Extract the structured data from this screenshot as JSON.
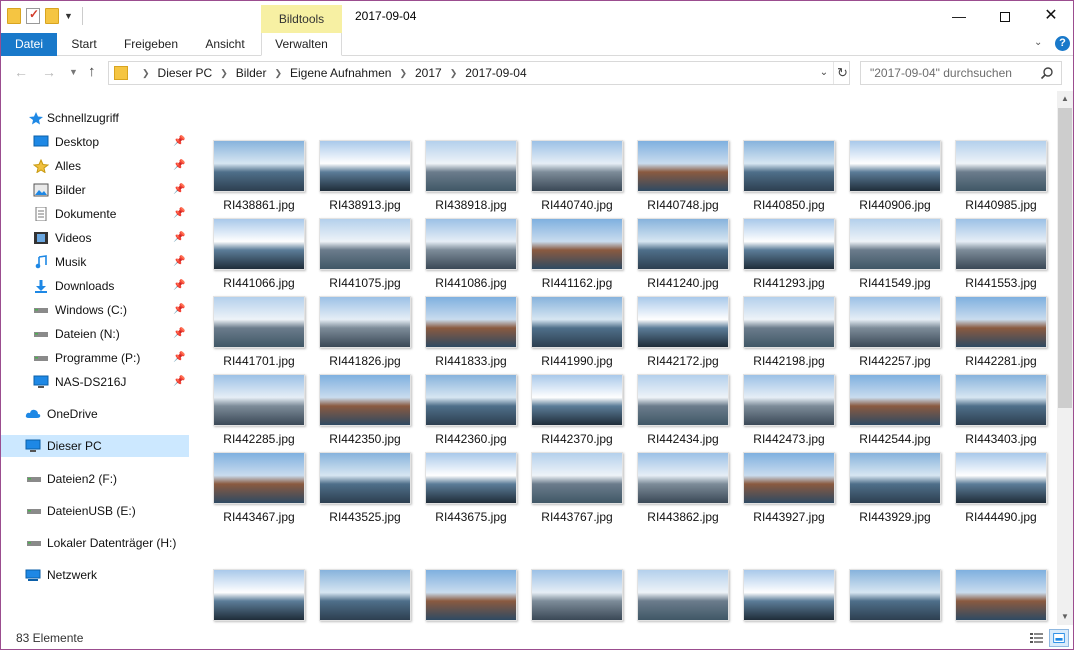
{
  "window": {
    "title": "2017-09-04",
    "context_tab_group": "Bildtools",
    "minimize_glyph": "—",
    "close_glyph": "✕"
  },
  "ribbon": {
    "tabs": [
      "Datei",
      "Start",
      "Freigeben",
      "Ansicht",
      "Verwalten"
    ],
    "help_glyph": "?",
    "accent": "#1979ca"
  },
  "address": {
    "breadcrumbs": [
      "Dieser PC",
      "Bilder",
      "Eigene Aufnahmen",
      "2017",
      "2017-09-04"
    ]
  },
  "search": {
    "placeholder": "\"2017-09-04\" durchsuchen"
  },
  "nav": {
    "quick_access": "Schnellzugriff",
    "pinned": [
      {
        "label": "Desktop",
        "icon": "desktop-icon"
      },
      {
        "label": "Alles",
        "icon": "star-icon"
      },
      {
        "label": "Bilder",
        "icon": "pictures-icon"
      },
      {
        "label": "Dokumente",
        "icon": "documents-icon"
      },
      {
        "label": "Videos",
        "icon": "videos-icon"
      },
      {
        "label": "Musik",
        "icon": "music-icon"
      },
      {
        "label": "Downloads",
        "icon": "downloads-icon"
      },
      {
        "label": "Windows (C:)",
        "icon": "drive-icon"
      },
      {
        "label": "Dateien (N:)",
        "icon": "drive-icon"
      },
      {
        "label": "Programme (P:)",
        "icon": "drive-icon"
      },
      {
        "label": "NAS-DS216J",
        "icon": "monitor-icon"
      }
    ],
    "onedrive": "OneDrive",
    "this_pc": "Dieser PC",
    "drives": [
      "Dateien2 (F:)",
      "DateienUSB (E:)",
      "Lokaler Datenträger (H:)"
    ],
    "network": "Netzwerk",
    "selection_color": "#cce8ff"
  },
  "files": [
    "RI438861.jpg",
    "RI438913.jpg",
    "RI438918.jpg",
    "RI440740.jpg",
    "RI440748.jpg",
    "RI440850.jpg",
    "RI440906.jpg",
    "RI440985.jpg",
    "RI441066.jpg",
    "RI441075.jpg",
    "RI441086.jpg",
    "RI441162.jpg",
    "RI441240.jpg",
    "RI441293.jpg",
    "RI441549.jpg",
    "RI441553.jpg",
    "RI441701.jpg",
    "RI441826.jpg",
    "RI441833.jpg",
    "RI441990.jpg",
    "RI442172.jpg",
    "RI442198.jpg",
    "RI442257.jpg",
    "RI442281.jpg",
    "RI442285.jpg",
    "RI442350.jpg",
    "RI442360.jpg",
    "RI442370.jpg",
    "RI442434.jpg",
    "RI442473.jpg",
    "RI442544.jpg",
    "RI443403.jpg",
    "RI443467.jpg",
    "RI443525.jpg",
    "RI443675.jpg",
    "RI443767.jpg",
    "RI443862.jpg",
    "RI443927.jpg",
    "RI443929.jpg",
    "RI444490.jpg"
  ],
  "partial_row_count": 8,
  "status": {
    "count_text": "83 Elemente"
  }
}
